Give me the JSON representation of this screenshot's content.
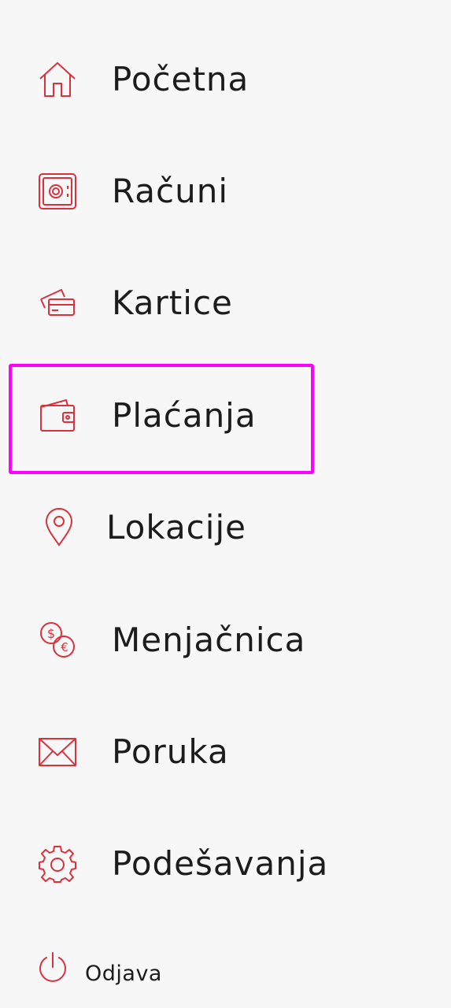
{
  "accent_color": "#d9323d",
  "highlight_color": "#ff00ff",
  "menu": {
    "items": [
      {
        "label": "Početna",
        "icon": "home-icon"
      },
      {
        "label": "Računi",
        "icon": "safe-icon"
      },
      {
        "label": "Kartice",
        "icon": "cards-icon"
      },
      {
        "label": "Plaćanja",
        "icon": "wallet-icon"
      },
      {
        "label": "Lokacije",
        "icon": "location-pin-icon"
      },
      {
        "label": "Menjačnica",
        "icon": "currency-exchange-icon"
      },
      {
        "label": "Poruka",
        "icon": "envelope-icon"
      },
      {
        "label": "Podešavanja",
        "icon": "gear-icon"
      }
    ],
    "logout": {
      "label": "Odjava",
      "icon": "power-icon"
    }
  }
}
